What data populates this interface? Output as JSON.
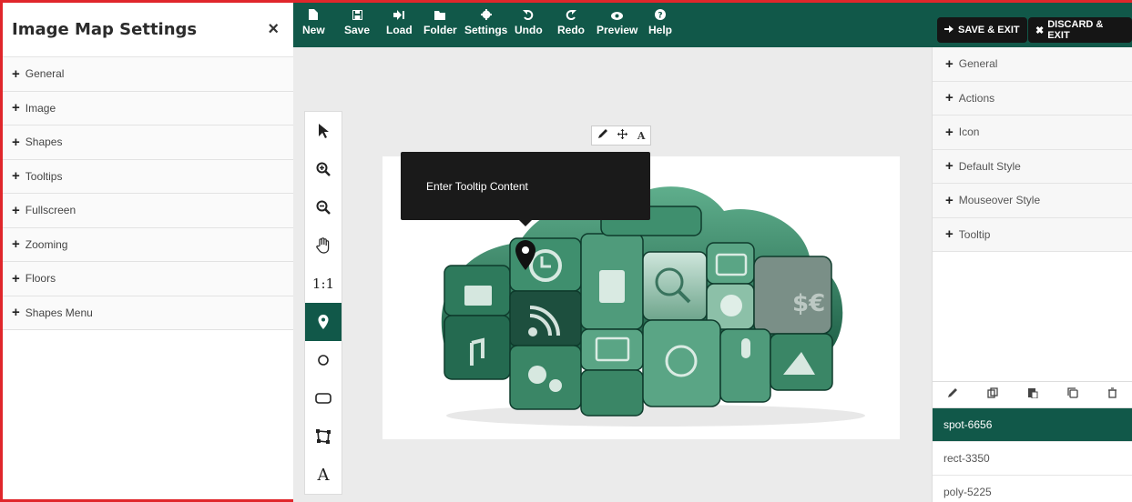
{
  "left_panel": {
    "title": "Image Map Settings",
    "close_label": "×",
    "items": [
      {
        "label": "General"
      },
      {
        "label": "Image"
      },
      {
        "label": "Shapes"
      },
      {
        "label": "Tooltips"
      },
      {
        "label": "Fullscreen"
      },
      {
        "label": "Zooming"
      },
      {
        "label": "Floors"
      },
      {
        "label": "Shapes Menu"
      }
    ]
  },
  "toolbar": {
    "buttons": [
      {
        "label": "New",
        "icon": "file-icon"
      },
      {
        "label": "Save",
        "icon": "save-icon"
      },
      {
        "label": "Load",
        "icon": "load-icon"
      },
      {
        "label": "Folder",
        "icon": "folder-icon"
      },
      {
        "label": "Settings",
        "icon": "gear-icon"
      },
      {
        "label": "Undo",
        "icon": "undo-icon"
      },
      {
        "label": "Redo",
        "icon": "redo-icon"
      },
      {
        "label": "Preview",
        "icon": "eye-icon"
      },
      {
        "label": "Help",
        "icon": "help-icon"
      }
    ],
    "save_exit": "SAVE & EXIT",
    "discard_exit": "DISCARD & EXIT"
  },
  "tools": [
    {
      "name": "select-tool",
      "icon": "cursor-icon",
      "text": ""
    },
    {
      "name": "zoom-in-tool",
      "icon": "zoom-in-icon",
      "text": ""
    },
    {
      "name": "zoom-out-tool",
      "icon": "zoom-out-icon",
      "text": ""
    },
    {
      "name": "pan-tool",
      "icon": "hand-icon",
      "text": ""
    },
    {
      "name": "reset-zoom-tool",
      "icon": "",
      "text": "1:1"
    },
    {
      "name": "spot-tool",
      "icon": "marker-icon",
      "text": ""
    },
    {
      "name": "circle-tool",
      "icon": "circle-icon",
      "text": ""
    },
    {
      "name": "rect-tool",
      "icon": "rounded-rect-icon",
      "text": ""
    },
    {
      "name": "poly-tool",
      "icon": "polygon-icon",
      "text": ""
    },
    {
      "name": "text-tool",
      "icon": "",
      "text": "A"
    }
  ],
  "active_tool": "spot-tool",
  "mini_toolbar": {
    "text_label": "A"
  },
  "tooltip": {
    "text": "Enter Tooltip Content"
  },
  "right_panel": {
    "items": [
      {
        "label": "General"
      },
      {
        "label": "Actions"
      },
      {
        "label": "Icon"
      },
      {
        "label": "Default Style"
      },
      {
        "label": "Mouseover Style"
      },
      {
        "label": "Tooltip"
      }
    ],
    "layers": [
      {
        "label": "spot-6656",
        "selected": true
      },
      {
        "label": "rect-3350",
        "selected": false
      },
      {
        "label": "poly-5225",
        "selected": false
      }
    ]
  },
  "colors": {
    "accent": "#115849",
    "cloud": "#2f7a60",
    "border": "#e0262b"
  }
}
